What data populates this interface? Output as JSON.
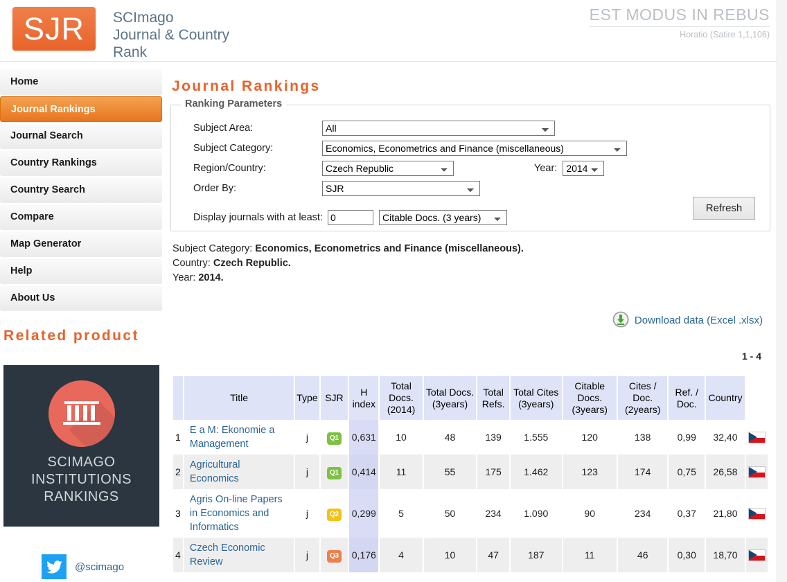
{
  "header": {
    "logo_mark": "SJR",
    "logo_text": "SCImago\nJournal & Country\nRank",
    "logo_line1": "SCImago",
    "logo_line2": "Journal & Country",
    "logo_line3": "Rank",
    "motto": "EST MODUS IN REBUS",
    "motto_source": "Horatio (Satire 1,1,106)",
    "brand_color": "#e8642a"
  },
  "sidebar": {
    "items": [
      {
        "label": "Home",
        "active": false
      },
      {
        "label": "Journal Rankings",
        "active": true
      },
      {
        "label": "Journal Search",
        "active": false
      },
      {
        "label": "Country Rankings",
        "active": false
      },
      {
        "label": "Country Search",
        "active": false
      },
      {
        "label": "Compare",
        "active": false
      },
      {
        "label": "Map Generator",
        "active": false
      },
      {
        "label": "Help",
        "active": false
      },
      {
        "label": "About Us",
        "active": false
      }
    ],
    "related_product_title": "Related product",
    "related_product_card": {
      "line1": "SCIMAGO",
      "line2": "INSTITUTIONS",
      "line3": "RANKINGS",
      "icon": "bank-columns-icon",
      "bg_color": "#2b3641",
      "circle_color": "#e8685c"
    },
    "twitter_handle": "@scimago"
  },
  "main": {
    "page_title": "Journal Rankings",
    "params": {
      "legend": "Ranking Parameters",
      "subject_area_label": "Subject Area:",
      "subject_area_value": "All",
      "subject_category_label": "Subject Category:",
      "subject_category_value": "Economics, Econometrics and Finance (miscellaneous)",
      "region_label": "Region/Country:",
      "region_value": "Czech Republic",
      "order_by_label": "Order By:",
      "order_by_value": "SJR",
      "year_label": "Year:",
      "year_value": "2014",
      "min_label": "Display journals with at least:",
      "min_value": "0",
      "min_metric_value": "Citable Docs. (3 years)",
      "refresh_label": "Refresh"
    },
    "summary": {
      "category_label": "Subject Category:",
      "category_value": "Economics, Econometrics and Finance (miscellaneous).",
      "country_label": "Country:",
      "country_value": "Czech Republic.",
      "year_label": "Year:",
      "year_value": "2014."
    },
    "download_label": "Download data (Excel .xlsx)",
    "result_range": "1 - 4"
  },
  "table": {
    "headers": [
      "",
      "Title",
      "Type",
      "SJR",
      "H index",
      "Total Docs. (2014)",
      "Total Docs. (3years)",
      "Total Refs.",
      "Total Cites (3years)",
      "Citable Docs. (3years)",
      "Cites / Doc. (2years)",
      "Ref. / Doc.",
      "Country"
    ],
    "headers_parts": {
      "title": "Title",
      "type": "Type",
      "sjr": "SJR",
      "h_index_l1": "H",
      "h_index_l2": "index",
      "total_docs_l1": "Total",
      "total_docs_l2": "Docs.",
      "total_docs_l3": "(2014)",
      "total_docs3_l1": "Total Docs.",
      "total_docs3_l2": "(3years)",
      "total_refs_l1": "Total",
      "total_refs_l2": "Refs.",
      "total_cites_l1": "Total Cites",
      "total_cites_l2": "(3years)",
      "citable_l1": "Citable",
      "citable_l2": "Docs.",
      "citable_l3": "(3years)",
      "cites_doc_l1": "Cites /",
      "cites_doc_l2": "Doc.",
      "cites_doc_l3": "(2years)",
      "ref_doc_l1": "Ref. /",
      "ref_doc_l2": "Doc.",
      "country": "Country"
    },
    "rows": [
      {
        "rank": "1",
        "title": "E a M: Ekonomie a Management",
        "type": "j",
        "quartile": "Q1",
        "sjr": "0,631",
        "h_index": "10",
        "total_docs": "48",
        "total_docs_3y": "139",
        "total_refs": "1.555",
        "total_cites_3y": "120",
        "citable_docs_3y": "138",
        "cites_doc_2y": "0,99",
        "ref_doc": "32,40",
        "country": "Czech Republic"
      },
      {
        "rank": "2",
        "title": "Agricultural Economics",
        "type": "j",
        "quartile": "Q1",
        "sjr": "0,414",
        "h_index": "11",
        "total_docs": "55",
        "total_docs_3y": "175",
        "total_refs": "1.462",
        "total_cites_3y": "123",
        "citable_docs_3y": "174",
        "cites_doc_2y": "0,75",
        "ref_doc": "26,58",
        "country": "Czech Republic"
      },
      {
        "rank": "3",
        "title": "Agris On-line Papers in Economics and Informatics",
        "type": "j",
        "quartile": "Q2",
        "sjr": "0,299",
        "h_index": "5",
        "total_docs": "50",
        "total_docs_3y": "234",
        "total_refs": "1.090",
        "total_cites_3y": "90",
        "citable_docs_3y": "234",
        "cites_doc_2y": "0,37",
        "ref_doc": "21,80",
        "country": "Czech Republic"
      },
      {
        "rank": "4",
        "title": "Czech Economic Review",
        "type": "j",
        "quartile": "Q3",
        "sjr": "0,176",
        "h_index": "4",
        "total_docs": "10",
        "total_docs_3y": "47",
        "total_refs": "187",
        "total_cites_3y": "11",
        "citable_docs_3y": "46",
        "cites_doc_2y": "0,30",
        "ref_doc": "18,70",
        "country": "Czech Republic"
      }
    ]
  }
}
